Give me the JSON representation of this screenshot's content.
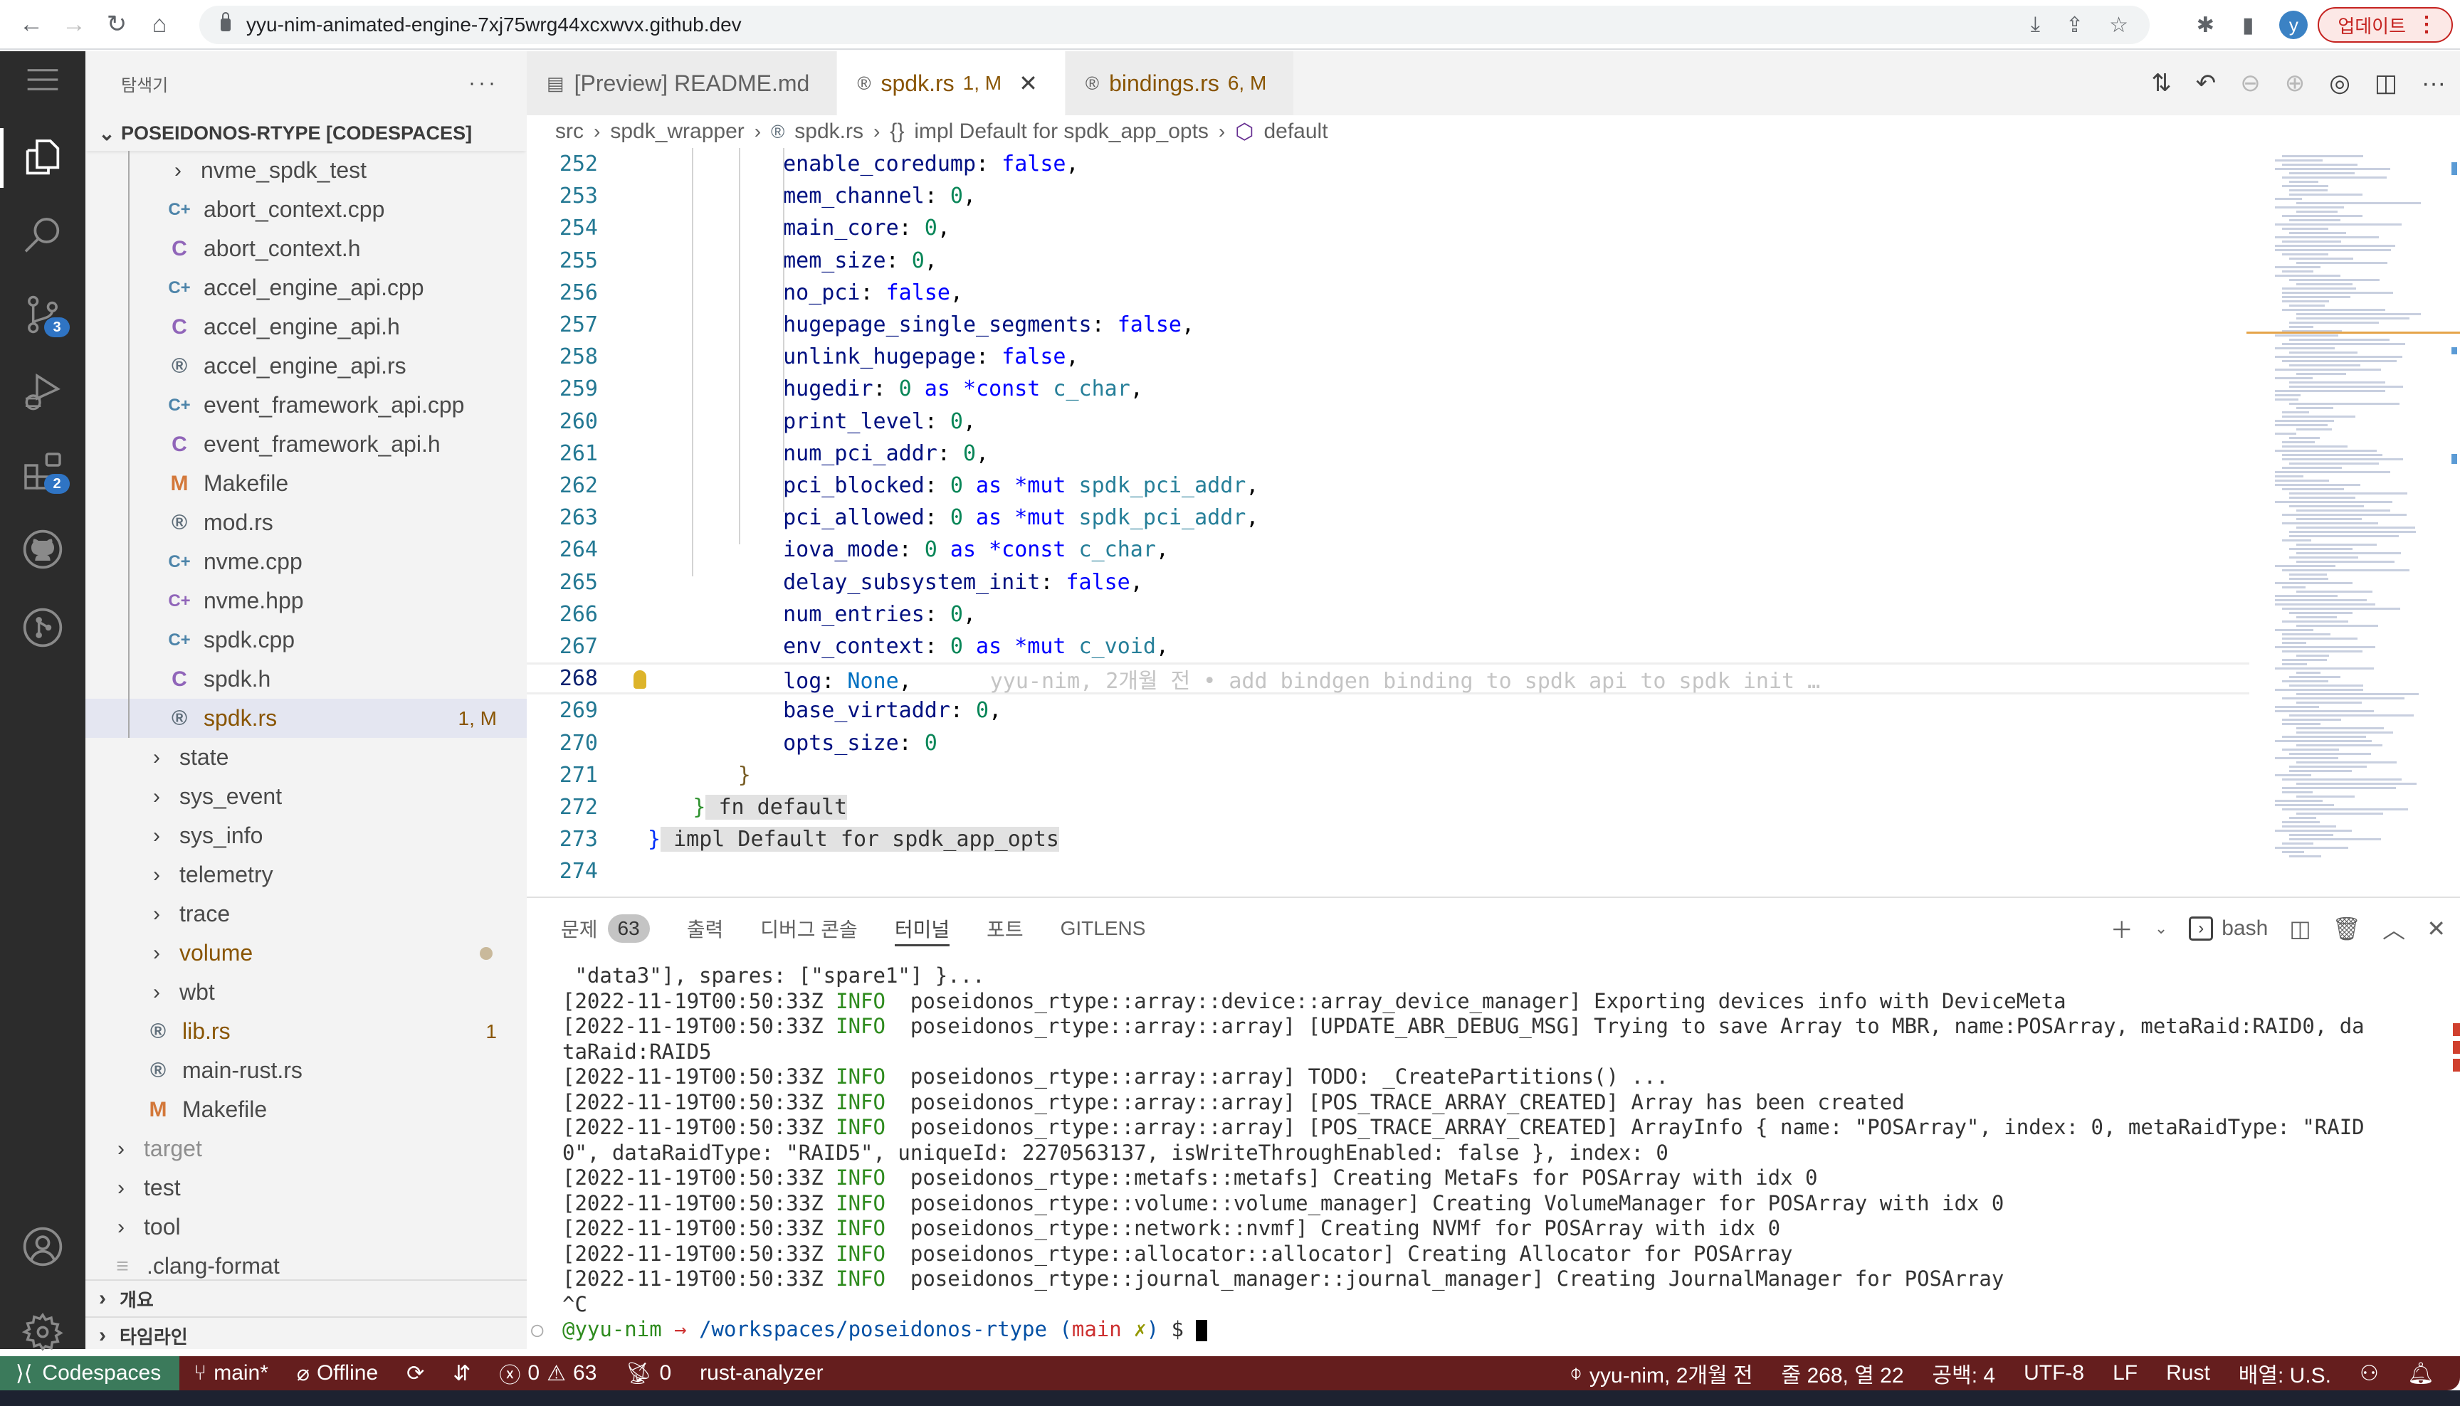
{
  "browser": {
    "url": "yyu-nim-animated-engine-7xj75wrg44xcxwvx.github.dev",
    "profile_initial": "y",
    "update_label": "업데이트",
    "nav": {
      "back": "←",
      "forward": "→",
      "reload": "↻",
      "home": "⌂"
    },
    "omni_icons": [
      "install-icon",
      "share-icon",
      "bookmark-star-icon"
    ],
    "omni_glyphs": {
      "install": "⤓",
      "share": "⇪",
      "star": "☆"
    },
    "ext_glyphs": {
      "extensions": "✱",
      "sidepanel": "▮"
    }
  },
  "activity_bar": {
    "items": [
      {
        "name": "explorer",
        "active": true
      },
      {
        "name": "search"
      },
      {
        "name": "source-control",
        "badge": "3"
      },
      {
        "name": "run-debug"
      },
      {
        "name": "extensions",
        "badge": "2"
      },
      {
        "name": "github"
      },
      {
        "name": "gitlens"
      }
    ],
    "bottom": [
      "accounts",
      "manage"
    ]
  },
  "sidebar": {
    "title": "탐색기",
    "more": "···",
    "workspace": "POSEIDONOS-RTYPE [CODESPACES]",
    "tree": [
      {
        "label": "nvme_spdk_test",
        "type": "folder",
        "depth": 2
      },
      {
        "label": "abort_context.cpp",
        "type": "cpp",
        "depth": 2
      },
      {
        "label": "abort_context.h",
        "type": "c",
        "depth": 2
      },
      {
        "label": "accel_engine_api.cpp",
        "type": "cpp",
        "depth": 2
      },
      {
        "label": "accel_engine_api.h",
        "type": "c",
        "depth": 2
      },
      {
        "label": "accel_engine_api.rs",
        "type": "rust",
        "depth": 2
      },
      {
        "label": "event_framework_api.cpp",
        "type": "cpp",
        "depth": 2
      },
      {
        "label": "event_framework_api.h",
        "type": "c",
        "depth": 2
      },
      {
        "label": "Makefile",
        "type": "make",
        "depth": 2
      },
      {
        "label": "mod.rs",
        "type": "rust",
        "depth": 2
      },
      {
        "label": "nvme.cpp",
        "type": "cpp",
        "depth": 2
      },
      {
        "label": "nvme.hpp",
        "type": "hpp",
        "depth": 2
      },
      {
        "label": "spdk.cpp",
        "type": "cpp",
        "depth": 2
      },
      {
        "label": "spdk.h",
        "type": "c",
        "depth": 2
      },
      {
        "label": "spdk.rs",
        "type": "rust",
        "depth": 2,
        "selected": true,
        "modified": true,
        "badge": "1, M"
      },
      {
        "label": "state",
        "type": "folder",
        "depth": 1
      },
      {
        "label": "sys_event",
        "type": "folder",
        "depth": 1
      },
      {
        "label": "sys_info",
        "type": "folder",
        "depth": 1
      },
      {
        "label": "telemetry",
        "type": "folder",
        "depth": 1
      },
      {
        "label": "trace",
        "type": "folder",
        "depth": 1
      },
      {
        "label": "volume",
        "type": "folder",
        "depth": 1,
        "modified": true,
        "dot": true
      },
      {
        "label": "wbt",
        "type": "folder",
        "depth": 1
      },
      {
        "label": "lib.rs",
        "type": "rust",
        "depth": 1,
        "modified": true,
        "badge": "1"
      },
      {
        "label": "main-rust.rs",
        "type": "rust",
        "depth": 1
      },
      {
        "label": "Makefile",
        "type": "make",
        "depth": 1
      },
      {
        "label": "target",
        "type": "folder",
        "depth": 0,
        "dim": true
      },
      {
        "label": "test",
        "type": "folder",
        "depth": 0
      },
      {
        "label": "tool",
        "type": "folder",
        "depth": 0
      },
      {
        "label": ".clang-format",
        "type": "clang",
        "depth": 0
      }
    ],
    "sections": [
      "개요",
      "타임라인"
    ]
  },
  "editor": {
    "tabs": [
      {
        "label": "[Preview] README.md",
        "icon": "preview-icon"
      },
      {
        "label": "spdk.rs",
        "status": "1, M",
        "active": true,
        "icon": "rust-icon"
      },
      {
        "label": "bindings.rs",
        "status": "6, M",
        "icon": "rust-icon"
      }
    ],
    "close_glyph": "✕",
    "breadcrumb": [
      "src",
      "spdk_wrapper",
      "spdk.rs",
      "impl Default for spdk_app_opts",
      "default"
    ],
    "breadcrumb_braces": "{}",
    "current_line": 268,
    "code": [
      {
        "n": 252,
        "ind": 3,
        "field": "enable_coredump",
        "val": [
          [
            "k-bool",
            "false"
          ]
        ],
        "end": ","
      },
      {
        "n": 253,
        "ind": 3,
        "field": "mem_channel",
        "val": [
          [
            "k-num",
            "0"
          ]
        ],
        "end": ","
      },
      {
        "n": 254,
        "ind": 3,
        "field": "main_core",
        "val": [
          [
            "k-num",
            "0"
          ]
        ],
        "end": ","
      },
      {
        "n": 255,
        "ind": 3,
        "field": "mem_size",
        "val": [
          [
            "k-num",
            "0"
          ]
        ],
        "end": ","
      },
      {
        "n": 256,
        "ind": 3,
        "field": "no_pci",
        "val": [
          [
            "k-bool",
            "false"
          ]
        ],
        "end": ","
      },
      {
        "n": 257,
        "ind": 3,
        "field": "hugepage_single_segments",
        "val": [
          [
            "k-bool",
            "false"
          ]
        ],
        "end": ","
      },
      {
        "n": 258,
        "ind": 3,
        "field": "unlink_hugepage",
        "val": [
          [
            "k-bool",
            "false"
          ]
        ],
        "end": ","
      },
      {
        "n": 259,
        "ind": 3,
        "field": "hugedir",
        "val": [
          [
            "k-num",
            "0"
          ],
          [
            "k-kw",
            " as *const "
          ],
          [
            "k-type",
            "c_char"
          ]
        ],
        "end": ","
      },
      {
        "n": 260,
        "ind": 3,
        "field": "print_level",
        "val": [
          [
            "k-num",
            "0"
          ]
        ],
        "end": ","
      },
      {
        "n": 261,
        "ind": 3,
        "field": "num_pci_addr",
        "val": [
          [
            "k-num",
            "0"
          ]
        ],
        "end": ","
      },
      {
        "n": 262,
        "ind": 3,
        "field": "pci_blocked",
        "val": [
          [
            "k-num",
            "0"
          ],
          [
            "k-kw",
            " as *mut "
          ],
          [
            "k-type",
            "spdk_pci_addr"
          ]
        ],
        "end": ","
      },
      {
        "n": 263,
        "ind": 3,
        "field": "pci_allowed",
        "val": [
          [
            "k-num",
            "0"
          ],
          [
            "k-kw",
            " as *mut "
          ],
          [
            "k-type",
            "spdk_pci_addr"
          ]
        ],
        "end": ","
      },
      {
        "n": 264,
        "ind": 3,
        "field": "iova_mode",
        "val": [
          [
            "k-num",
            "0"
          ],
          [
            "k-kw",
            " as *const "
          ],
          [
            "k-type",
            "c_char"
          ]
        ],
        "end": ","
      },
      {
        "n": 265,
        "ind": 3,
        "field": "delay_subsystem_init",
        "val": [
          [
            "k-bool",
            "false"
          ]
        ],
        "end": ","
      },
      {
        "n": 266,
        "ind": 3,
        "field": "num_entries",
        "val": [
          [
            "k-num",
            "0"
          ]
        ],
        "end": ","
      },
      {
        "n": 267,
        "ind": 3,
        "field": "env_context",
        "val": [
          [
            "k-num",
            "0"
          ],
          [
            "k-kw",
            " as *mut "
          ],
          [
            "k-type",
            "c_void"
          ]
        ],
        "end": ","
      },
      {
        "n": 268,
        "ind": 3,
        "field": "log",
        "val": [
          [
            "k-none",
            "None"
          ]
        ],
        "end": ",",
        "blame": "yyu-nim, 2개월 전 • add bindgen binding to spdk api to spdk init …"
      },
      {
        "n": 269,
        "ind": 3,
        "field": "base_virtaddr",
        "val": [
          [
            "k-num",
            "0"
          ]
        ],
        "end": ","
      },
      {
        "n": 270,
        "ind": 3,
        "field": "opts_size",
        "val": [
          [
            "k-num",
            "0"
          ]
        ],
        "end": ""
      },
      {
        "n": 271,
        "ind": 2,
        "raw": [
          [
            "k-brace-y",
            "}"
          ]
        ]
      },
      {
        "n": 272,
        "ind": 1,
        "raw": [
          [
            "k-brace-g",
            "}"
          ],
          [
            "k-sticky",
            " fn default"
          ]
        ]
      },
      {
        "n": 273,
        "ind": 0,
        "raw": [
          [
            "k-brace-b",
            "}"
          ],
          [
            "k-sticky",
            " impl Default for spdk_app_opts"
          ]
        ]
      },
      {
        "n": 274,
        "ind": 0,
        "raw": []
      }
    ],
    "action_icons": [
      "compare-changes-icon",
      "go-back-icon",
      "previous-change-icon",
      "next-change-icon",
      "gitlens-icon",
      "split-editor-icon",
      "more-actions-icon"
    ]
  },
  "panel": {
    "tabs": [
      {
        "label": "문제",
        "count": "63"
      },
      {
        "label": "출력"
      },
      {
        "label": "디버그 콘솔"
      },
      {
        "label": "터미널",
        "active": true
      },
      {
        "label": "포트"
      },
      {
        "label": "GITLENS"
      }
    ],
    "terminal_name": "bash",
    "terminal_lines": [
      {
        "parts": [
          [
            "",
            " \"data3\"], spares: [\"spare1\"] }..."
          ]
        ]
      },
      {
        "parts": [
          [
            "",
            "[2022-11-19T00:50:33Z "
          ],
          [
            "t-info",
            "INFO"
          ],
          [
            "",
            "  poseidonos_rtype::array::device::array_device_manager] Exporting devices info with DeviceMeta"
          ]
        ]
      },
      {
        "parts": [
          [
            "",
            "[2022-11-19T00:50:33Z "
          ],
          [
            "t-info",
            "INFO"
          ],
          [
            "",
            "  poseidonos_rtype::array::array] [UPDATE_ABR_DEBUG_MSG] Trying to save Array to MBR, name:POSArray, metaRaid:RAID0, da"
          ]
        ]
      },
      {
        "parts": [
          [
            "",
            "taRaid:RAID5"
          ]
        ]
      },
      {
        "parts": [
          [
            "",
            "[2022-11-19T00:50:33Z "
          ],
          [
            "t-info",
            "INFO"
          ],
          [
            "",
            "  poseidonos_rtype::array::array] TODO: _CreatePartitions() ..."
          ]
        ]
      },
      {
        "parts": [
          [
            "",
            "[2022-11-19T00:50:33Z "
          ],
          [
            "t-info",
            "INFO"
          ],
          [
            "",
            "  poseidonos_rtype::array::array] [POS_TRACE_ARRAY_CREATED] Array has been created"
          ]
        ]
      },
      {
        "parts": [
          [
            "",
            "[2022-11-19T00:50:33Z "
          ],
          [
            "t-info",
            "INFO"
          ],
          [
            "",
            "  poseidonos_rtype::array::array] [POS_TRACE_ARRAY_CREATED] ArrayInfo { name: \"POSArray\", index: 0, metaRaidType: \"RAID"
          ]
        ]
      },
      {
        "parts": [
          [
            "",
            "0\", dataRaidType: \"RAID5\", uniqueId: 2270563137, isWriteThroughEnabled: false }, index: 0"
          ]
        ]
      },
      {
        "parts": [
          [
            "",
            "[2022-11-19T00:50:33Z "
          ],
          [
            "t-info",
            "INFO"
          ],
          [
            "",
            "  poseidonos_rtype::metafs::metafs] Creating MetaFs for POSArray with idx 0"
          ]
        ]
      },
      {
        "parts": [
          [
            "",
            "[2022-11-19T00:50:33Z "
          ],
          [
            "t-info",
            "INFO"
          ],
          [
            "",
            "  poseidonos_rtype::volume::volume_manager] Creating VolumeManager for POSArray with idx 0"
          ]
        ]
      },
      {
        "parts": [
          [
            "",
            "[2022-11-19T00:50:33Z "
          ],
          [
            "t-info",
            "INFO"
          ],
          [
            "",
            "  poseidonos_rtype::network::nvmf] Creating NVMf for POSArray with idx 0"
          ]
        ]
      },
      {
        "parts": [
          [
            "",
            "[2022-11-19T00:50:33Z "
          ],
          [
            "t-info",
            "INFO"
          ],
          [
            "",
            "  poseidonos_rtype::allocator::allocator] Creating Allocator for POSArray"
          ]
        ]
      },
      {
        "parts": [
          [
            "",
            "[2022-11-19T00:50:33Z "
          ],
          [
            "t-info",
            "INFO"
          ],
          [
            "",
            "  poseidonos_rtype::journal_manager::journal_manager] Creating JournalManager for POSArray"
          ]
        ]
      },
      {
        "parts": [
          [
            "",
            "^C"
          ]
        ]
      },
      {
        "prompt": true,
        "parts": [
          [
            "t-green",
            "@yyu-nim "
          ],
          [
            "t-red",
            "→ "
          ],
          [
            "t-blue",
            "/workspaces/poseidonos-rtype "
          ],
          [
            "t-blue",
            "("
          ],
          [
            "t-red",
            "main"
          ],
          [
            "t-yellow",
            " ✗"
          ],
          [
            "t-blue",
            ")"
          ],
          [
            "",
            " $ "
          ]
        ]
      }
    ]
  },
  "statusbar": {
    "remote": "Codespaces",
    "branch": "main*",
    "network": "Offline",
    "errors": "0",
    "warnings": "63",
    "ports": "0",
    "language_server": "rust-analyzer",
    "blame": "yyu-nim, 2개월 전",
    "position": "줄 268, 열 22",
    "indent": "공백: 4",
    "encoding": "UTF-8",
    "eol": "LF",
    "language": "Rust",
    "layout": "배열: U.S.",
    "colors": {
      "remote_bg": "#3b7a5b",
      "bar_bg": "#651e1e"
    }
  }
}
